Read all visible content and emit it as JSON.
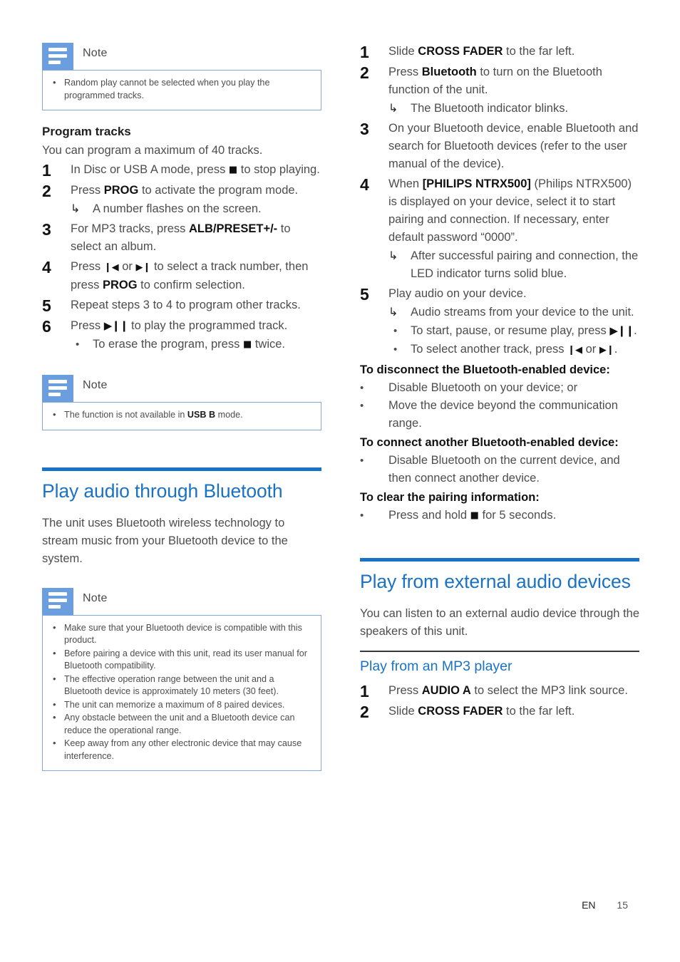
{
  "document": {
    "language_code": "EN",
    "page_number": "15"
  },
  "colors": {
    "heading_blue": "#1a72c4",
    "note_icon_blue": "#6b9ede",
    "note_border_blue": "#7fa9dd",
    "rule_dark": "#33393d"
  },
  "icons": {
    "note_icon": "note-lines-icon"
  },
  "left_column": {
    "note_1": {
      "title": "Note",
      "items": [
        "Random play cannot be selected when you play the programmed tracks."
      ]
    },
    "program_tracks": {
      "heading": "Program tracks",
      "intro": "You can program a maximum of 40 tracks.",
      "steps": [
        {
          "num": "1",
          "parts": [
            {
              "t": "text",
              "v": "In Disc or USB A mode, press "
            },
            {
              "t": "glyph",
              "v": "■"
            },
            {
              "t": "text",
              "v": " to stop playing."
            }
          ]
        },
        {
          "num": "2",
          "parts": [
            {
              "t": "text",
              "v": "Press "
            },
            {
              "t": "bold",
              "v": "PROG"
            },
            {
              "t": "text",
              "v": " to activate the program mode."
            }
          ],
          "sub": [
            {
              "type": "arrow",
              "text": "A number flashes on the screen."
            }
          ]
        },
        {
          "num": "3",
          "parts": [
            {
              "t": "text",
              "v": "For MP3 tracks, press "
            },
            {
              "t": "bold",
              "v": "ALB/PRESET+/-"
            },
            {
              "t": "text",
              "v": " to select an album."
            }
          ]
        },
        {
          "num": "4",
          "parts": [
            {
              "t": "text",
              "v": "Press "
            },
            {
              "t": "glyph",
              "v": "⏮"
            },
            {
              "t": "text",
              "v": " or "
            },
            {
              "t": "glyph",
              "v": "⏭"
            },
            {
              "t": "text",
              "v": " to select a track number, then press "
            },
            {
              "t": "bold",
              "v": "PROG"
            },
            {
              "t": "text",
              "v": " to confirm selection."
            }
          ]
        },
        {
          "num": "5",
          "parts": [
            {
              "t": "text",
              "v": "Repeat steps 3 to 4 to program other tracks."
            }
          ]
        },
        {
          "num": "6",
          "parts": [
            {
              "t": "text",
              "v": "Press "
            },
            {
              "t": "glyph",
              "v": "▶❙❙"
            },
            {
              "t": "text",
              "v": " to play the programmed track."
            }
          ],
          "sub": [
            {
              "type": "bullet",
              "text": "To erase the program, press ■ twice."
            }
          ]
        }
      ]
    },
    "note_2": {
      "title": "Note",
      "items": [
        "The function is not available in USB B mode."
      ]
    },
    "section_bluetooth": {
      "heading": "Play audio through Bluetooth",
      "intro": "The unit uses Bluetooth wireless technology to stream music from your Bluetooth device to the system."
    },
    "note_3": {
      "title": "Note",
      "items": [
        "Make sure that your Bluetooth device is compatible with this product.",
        "Before pairing a device with this unit, read its user manual for Bluetooth compatibility.",
        "The effective operation range between the unit and a Bluetooth device is approximately 10 meters (30 feet).",
        "The unit can memorize a maximum of 8 paired devices.",
        "Any obstacle between the unit and a Bluetooth device can reduce the operational range.",
        "Keep away from any other electronic device that may cause interference."
      ]
    }
  },
  "right_column": {
    "bluetooth_steps": [
      {
        "num": "1",
        "parts": [
          {
            "t": "text",
            "v": "Slide "
          },
          {
            "t": "bold",
            "v": "CROSS FADER"
          },
          {
            "t": "text",
            "v": " to the far left."
          }
        ]
      },
      {
        "num": "2",
        "parts": [
          {
            "t": "text",
            "v": "Press "
          },
          {
            "t": "bold",
            "v": "Bluetooth"
          },
          {
            "t": "text",
            "v": " to turn on the Bluetooth function of the unit."
          }
        ],
        "sub": [
          {
            "type": "arrow",
            "text": "The Bluetooth indicator blinks."
          }
        ]
      },
      {
        "num": "3",
        "parts": [
          {
            "t": "text",
            "v": "On your Bluetooth device, enable Bluetooth and search for Bluetooth devices (refer to the user manual of the device)."
          }
        ]
      },
      {
        "num": "4",
        "parts": [
          {
            "t": "text",
            "v": "When "
          },
          {
            "t": "bold",
            "v": "[PHILIPS NTRX500]"
          },
          {
            "t": "text",
            "v": " (Philips NTRX500) is displayed on your device, select it to start pairing and connection. If necessary, enter default password “0000”."
          }
        ],
        "sub": [
          {
            "type": "arrow",
            "text": "After successful pairing and connection, the LED indicator turns solid blue."
          }
        ]
      },
      {
        "num": "5",
        "parts": [
          {
            "t": "text",
            "v": "Play audio on your device."
          }
        ],
        "sub": [
          {
            "type": "arrow",
            "text": "Audio streams from your device to the unit."
          },
          {
            "type": "bullet",
            "text": "To start, pause, or resume play, press ▶❙❙."
          },
          {
            "type": "bullet",
            "text": "To select another track, press ⏮ or ⏭."
          }
        ]
      }
    ],
    "disconnect": {
      "lead": "To disconnect the Bluetooth-enabled device:",
      "bullets": [
        "Disable Bluetooth on your device; or",
        "Move the device beyond the communication range."
      ]
    },
    "connect_another": {
      "lead": "To connect another Bluetooth-enabled device:",
      "bullets": [
        "Disable Bluetooth on the current device, and then connect another device."
      ]
    },
    "clear_pairing": {
      "lead": "To clear the pairing information:",
      "bullets": [
        "Press and hold ■ for 5 seconds."
      ]
    },
    "section_external": {
      "heading": "Play from external audio devices",
      "intro": "You can listen to an external audio device through the speakers of this unit.",
      "subheading": "Play from an MP3 player",
      "steps": [
        {
          "num": "1",
          "parts": [
            {
              "t": "text",
              "v": "Press "
            },
            {
              "t": "bold",
              "v": "AUDIO A"
            },
            {
              "t": "text",
              "v": " to select the MP3 link source."
            }
          ]
        },
        {
          "num": "2",
          "parts": [
            {
              "t": "text",
              "v": "Slide "
            },
            {
              "t": "bold",
              "v": "CROSS FADER"
            },
            {
              "t": "text",
              "v": " to the far left."
            }
          ]
        }
      ]
    }
  }
}
